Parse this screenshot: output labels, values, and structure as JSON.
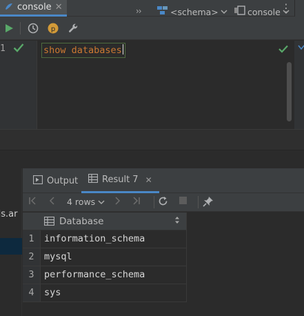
{
  "tab": {
    "label": "console",
    "close_glyph": "✕",
    "menu_glyph": "⋮"
  },
  "toolbar": {
    "run_icon": "play-icon",
    "history_icon": "clock-icon",
    "profile_glyph": "p",
    "chevrons": "››",
    "schema_label": "<schema>",
    "console_label": "console",
    "dropdown_glyph": "⌄"
  },
  "editor": {
    "line_number": "1",
    "code": "show databases",
    "status": "ok"
  },
  "services": {
    "partial_text": "ds.ar"
  },
  "results": {
    "tabs": [
      {
        "label": "Output"
      },
      {
        "label": "Result 7"
      }
    ],
    "rows_label": "4 rows",
    "column_header": "Database",
    "rows": [
      {
        "num": "1",
        "value": "information_schema"
      },
      {
        "num": "2",
        "value": "mysql"
      },
      {
        "num": "3",
        "value": "performance_schema"
      },
      {
        "num": "4",
        "value": "sys"
      }
    ]
  },
  "colors": {
    "accent": "#4a88c7",
    "keyword": "#cc7832",
    "success": "#59a869",
    "background": "#2b2b2b",
    "panel": "#3c3f41"
  }
}
